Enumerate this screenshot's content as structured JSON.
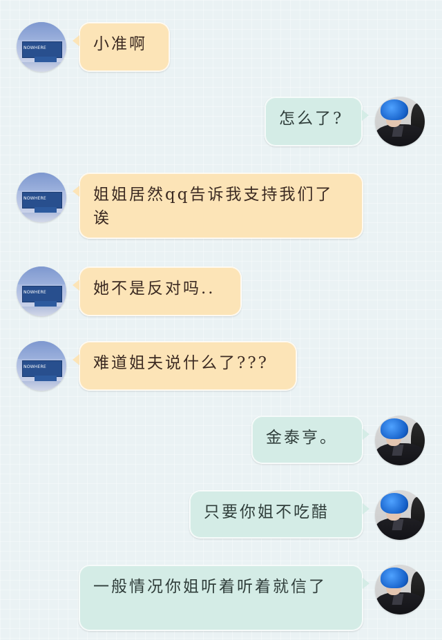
{
  "avatars": {
    "left": {
      "sign_text": "NOWHERE",
      "icon": "highway-sign-avatar"
    },
    "right": {
      "icon": "blue-hair-person-avatar"
    }
  },
  "messages": [
    {
      "side": "left",
      "text": "小准啊"
    },
    {
      "side": "right",
      "text": "怎么了?"
    },
    {
      "side": "left",
      "text": "姐姐居然qq告诉我支持我们了诶"
    },
    {
      "side": "left",
      "text": "她不是反对吗.."
    },
    {
      "side": "left",
      "text": "难道姐夫说什么了???"
    },
    {
      "side": "right",
      "text": "金泰亨。"
    },
    {
      "side": "right",
      "text": "只要你姐不吃醋"
    },
    {
      "side": "right",
      "text": "一般情况你姐听着听着就信了"
    }
  ],
  "colors": {
    "left_bubble": "#fce4b7",
    "right_bubble": "#d4ece6",
    "background": "#eaf2f4"
  }
}
